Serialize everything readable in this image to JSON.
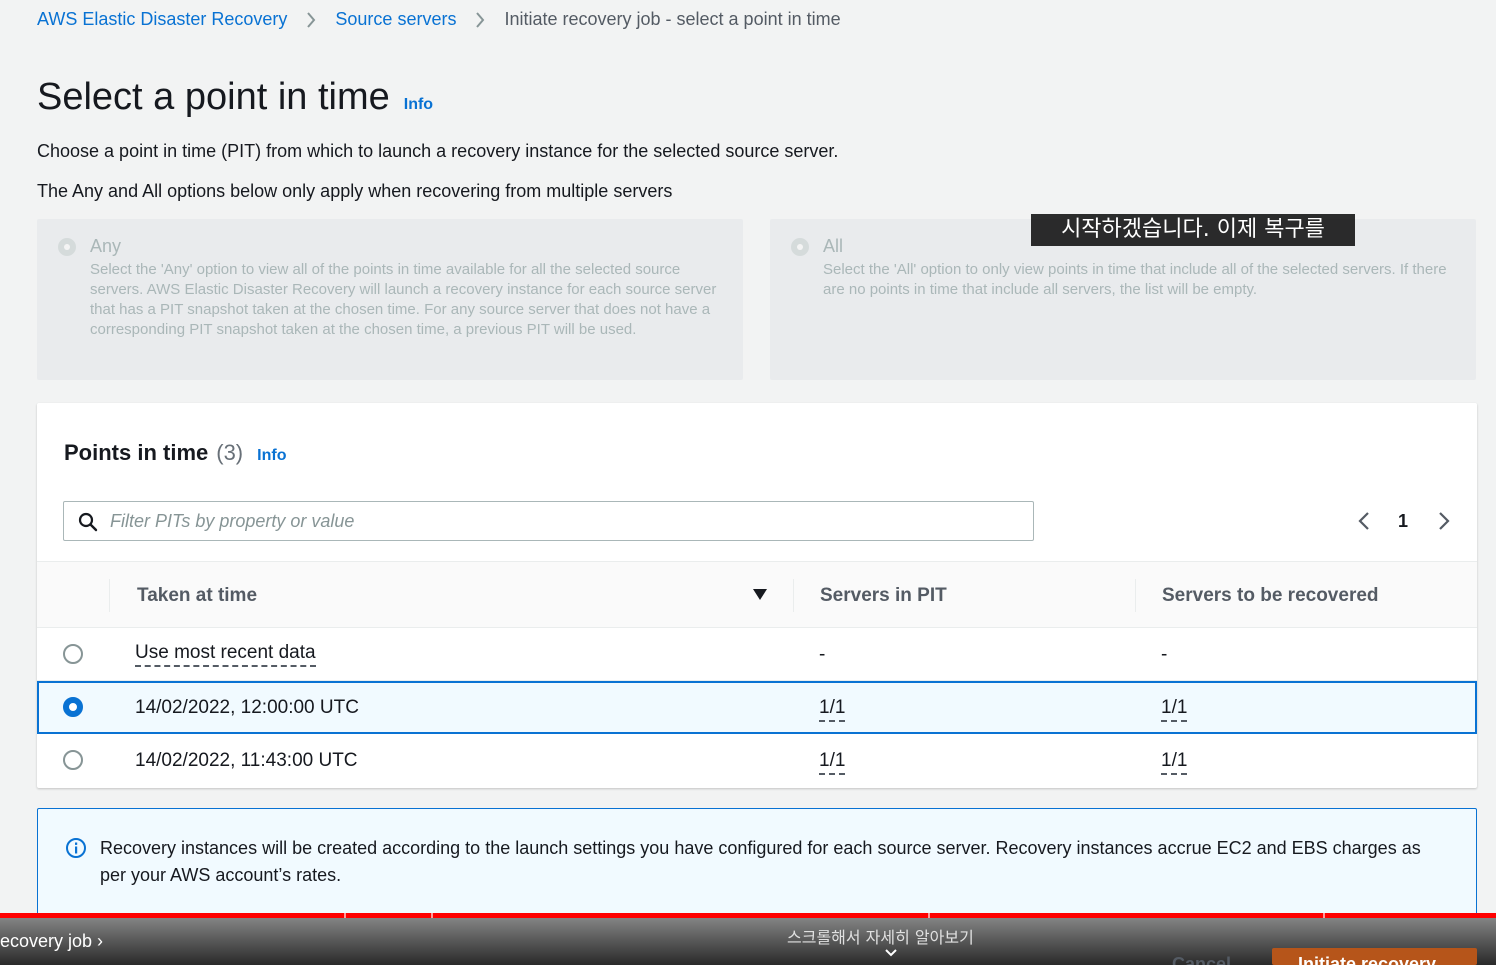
{
  "breadcrumb": {
    "items": [
      "AWS Elastic Disaster Recovery",
      "Source servers",
      "Initiate recovery job - select a point in time"
    ]
  },
  "page": {
    "title": "Select a point in time",
    "info_label": "Info",
    "description": "Choose a point in time (PIT) from which to launch a recovery instance for the selected source server.",
    "options_note": "The Any and All options below only apply when recovering from multiple servers"
  },
  "options": {
    "any": {
      "label": "Any",
      "description": "Select the 'Any' option to view all of the points in time available for all the selected source servers. AWS Elastic Disaster Recovery will launch a recovery instance for each source server that has a PIT snapshot taken at the chosen time. For any source server that does not have a corresponding PIT snapshot taken at the chosen time, a previous PIT will be used.",
      "selected": false,
      "disabled": true
    },
    "all": {
      "label": "All",
      "description": "Select the 'All' option to only view points in time that include all of the selected servers. If there are no points in time that include all servers, the list will be empty.",
      "selected": false,
      "disabled": true
    }
  },
  "overlay_subtitle": "시작하겠습니다. 이제 복구를",
  "pit_table": {
    "title": "Points in time",
    "count": "(3)",
    "info_label": "Info",
    "filter_placeholder": "Filter PITs by property or value",
    "current_page": "1",
    "columns": [
      "Taken at time",
      "Servers in PIT",
      "Servers to be recovered"
    ],
    "rows": [
      {
        "taken_at": "Use most recent data",
        "servers_in_pit": "-",
        "servers_to_recover": "-",
        "selected": false
      },
      {
        "taken_at": "14/02/2022, 12:00:00 UTC",
        "servers_in_pit": "1/1",
        "servers_to_recover": "1/1",
        "selected": true
      },
      {
        "taken_at": "14/02/2022, 11:43:00 UTC",
        "servers_in_pit": "1/1",
        "servers_to_recover": "1/1",
        "selected": false
      }
    ]
  },
  "alert": {
    "icon": "info-icon",
    "text": "Recovery instances will be created according to the launch settings you have configured for each source server. Recovery instances accrue EC2 and EBS charges as per your AWS account’s rates."
  },
  "video_overlay": {
    "chapter": "ecovery job ›",
    "scroll_hint": "스크롤해서 자세히 알아보기",
    "cancel_label": "Cancel",
    "primary_label": "Initiate recovery"
  },
  "colors": {
    "link": "#0972d3",
    "selected_row_bg": "#f1faff",
    "primary_button": "#b6551a",
    "progress": "#ff0000"
  }
}
